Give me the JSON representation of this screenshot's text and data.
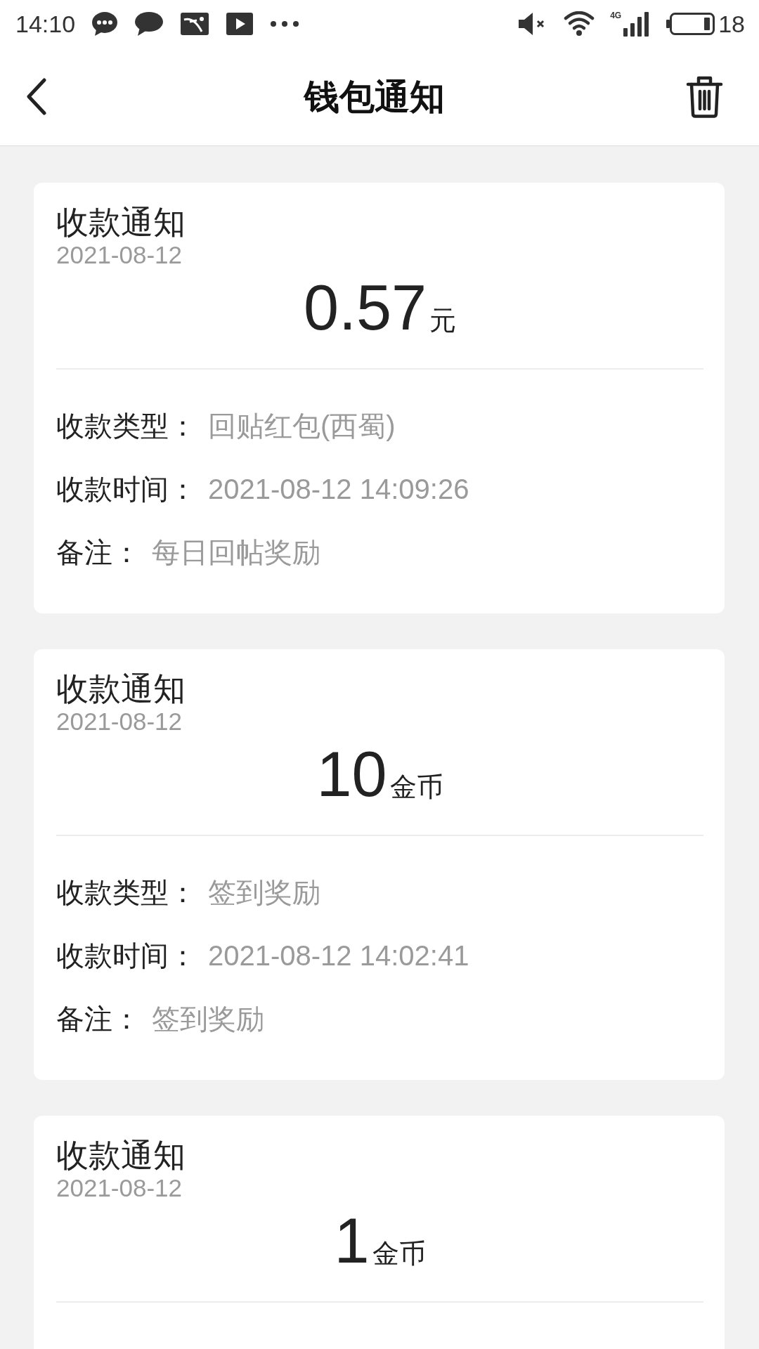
{
  "status_bar": {
    "time": "14:10",
    "network_type": "4G",
    "battery_text": "18"
  },
  "header": {
    "title": "钱包通知"
  },
  "notifications": [
    {
      "title": "收款通知",
      "date": "2021-08-12",
      "amount": "0.57",
      "unit": "元",
      "details": [
        {
          "label": "收款类型：",
          "value": "回贴红包(西蜀)"
        },
        {
          "label": "收款时间：",
          "value": "2021-08-12 14:09:26"
        },
        {
          "label": "备注：",
          "value": "每日回帖奖励"
        }
      ]
    },
    {
      "title": "收款通知",
      "date": "2021-08-12",
      "amount": "10",
      "unit": "金币",
      "details": [
        {
          "label": "收款类型：",
          "value": "签到奖励"
        },
        {
          "label": "收款时间：",
          "value": "2021-08-12 14:02:41"
        },
        {
          "label": "备注：",
          "value": "签到奖励"
        }
      ]
    },
    {
      "title": "收款通知",
      "date": "2021-08-12",
      "amount": "1",
      "unit": "金币"
    }
  ]
}
